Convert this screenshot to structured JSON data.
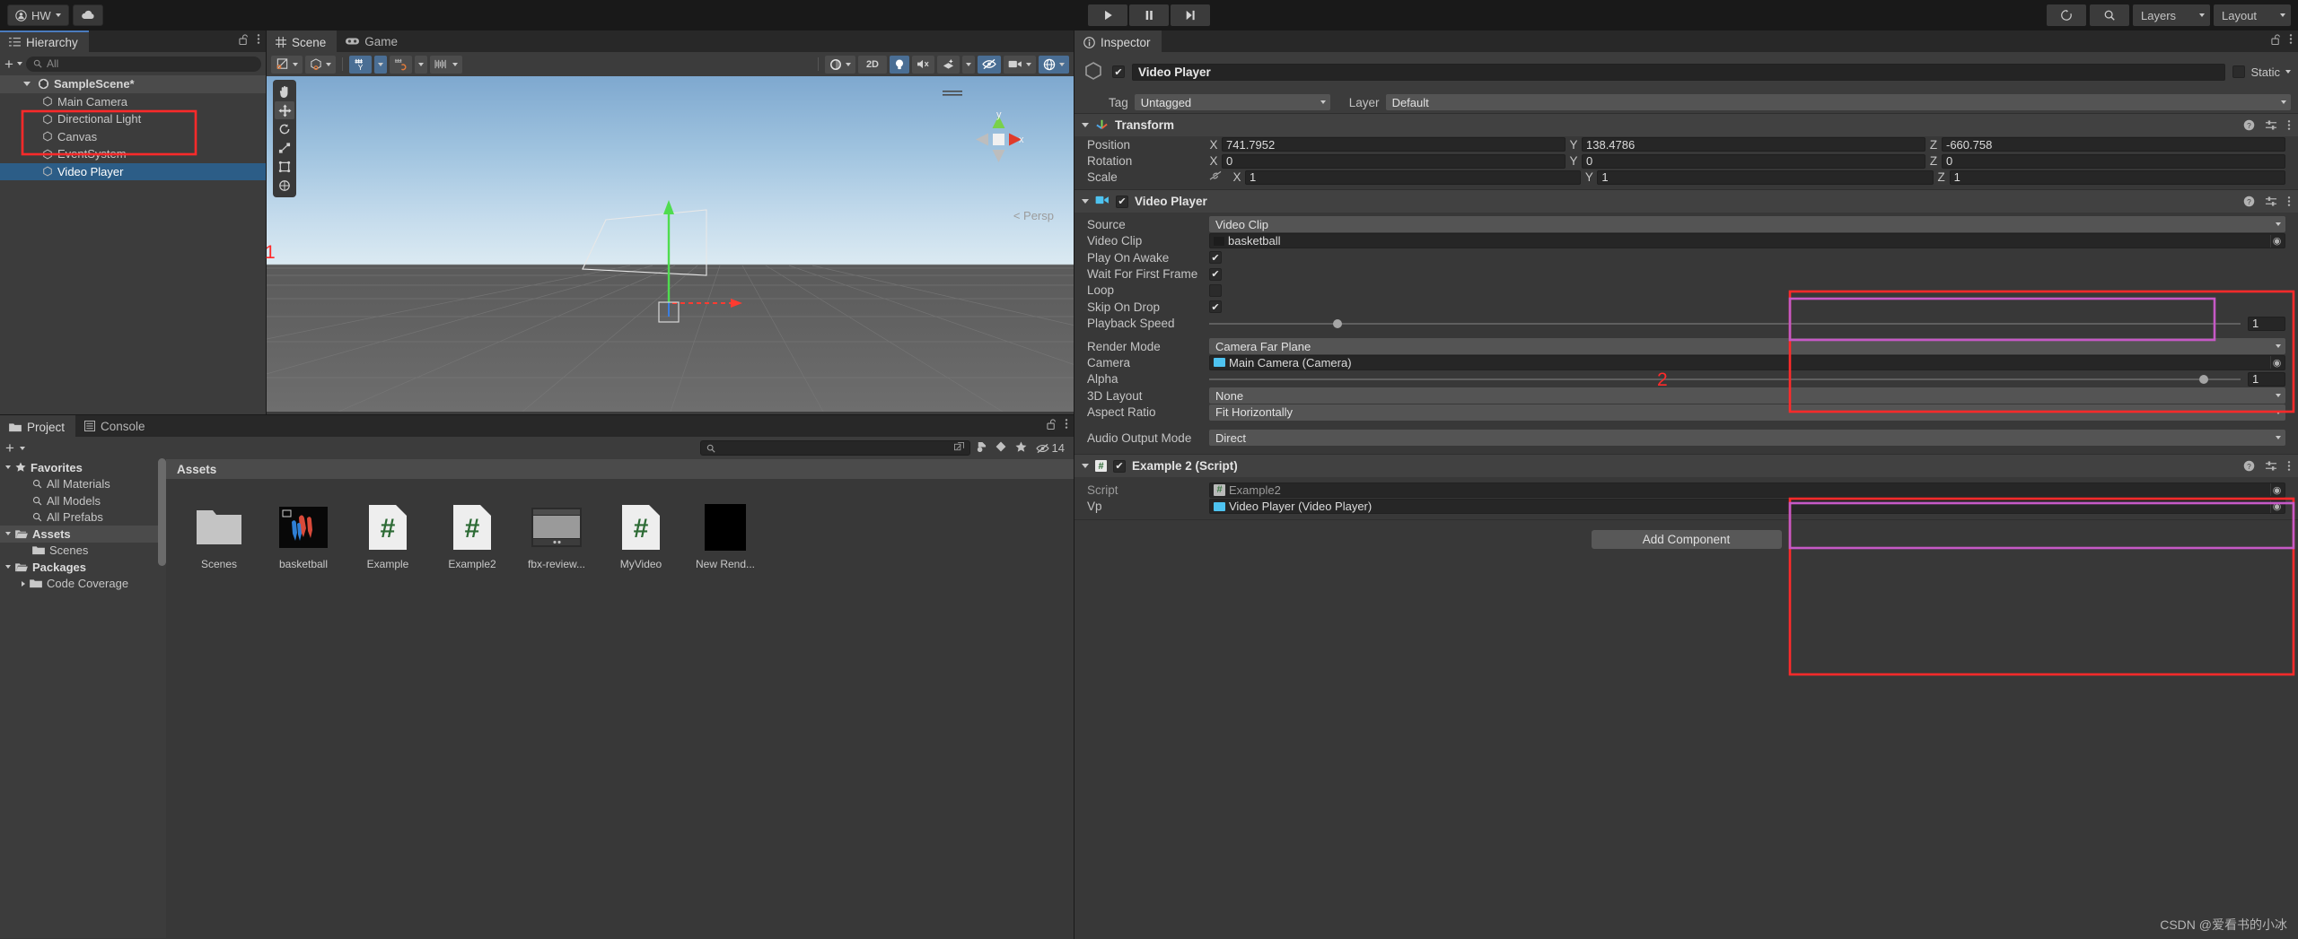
{
  "topbar": {
    "account": "HW",
    "account_icon": "person-icon",
    "cloud_icon": "cloud-icon",
    "play": "play-icon",
    "pause": "pause-icon",
    "step": "step-icon",
    "history_icon": "history-icon",
    "search_icon": "search-icon",
    "layers": "Layers",
    "layout": "Layout"
  },
  "hierarchy": {
    "tab": "Hierarchy",
    "tab_icon": "hierarchy-icon",
    "lock_icon": "lock-open-icon",
    "menu_icon": "kebab-menu-icon",
    "add_label": "+",
    "search_placeholder": "All",
    "items": [
      {
        "label": "SampleScene*",
        "type": "scene",
        "depth": 0
      },
      {
        "label": "Main Camera",
        "type": "object",
        "depth": 1
      },
      {
        "label": "Directional Light",
        "type": "object",
        "depth": 1
      },
      {
        "label": "Canvas",
        "type": "object",
        "depth": 1
      },
      {
        "label": "EventSystem",
        "type": "object",
        "depth": 1
      },
      {
        "label": "Video Player",
        "type": "object",
        "depth": 1,
        "selected": true
      }
    ]
  },
  "scene": {
    "tabs": [
      {
        "label": "Scene",
        "icon": "grid-icon",
        "active": true
      },
      {
        "label": "Game",
        "icon": "gamepad-icon",
        "active": false
      }
    ],
    "lock_icon": "lock-open-icon",
    "menu_icon": "kebab-menu-icon",
    "toolbar_left": [
      {
        "name": "pivot-mode",
        "label": "⊘"
      },
      {
        "name": "handle-space",
        "label": "⬚"
      },
      {
        "name": "grid-snap",
        "label": "✥",
        "active": true
      },
      {
        "name": "magnet-snap",
        "label": "⌗"
      },
      {
        "name": "ruler",
        "label": "|||"
      }
    ],
    "toolbar_right": [
      {
        "name": "shading-mode",
        "label": "◐"
      },
      {
        "name": "2d-toggle",
        "label": "2D"
      },
      {
        "name": "lighting-toggle",
        "label": "💡",
        "active": true
      },
      {
        "name": "audio-toggle",
        "label": "🔇"
      },
      {
        "name": "fx-toggle",
        "label": "✨"
      },
      {
        "name": "hidden-toggle",
        "label": "👁",
        "active": true
      },
      {
        "name": "camera-toggle",
        "label": "🎥"
      },
      {
        "name": "gizmo-toggle",
        "label": "◉",
        "active": true
      }
    ],
    "tools": [
      {
        "name": "hand-tool",
        "glyph": "✋"
      },
      {
        "name": "move-tool",
        "glyph": "✥",
        "active": true
      },
      {
        "name": "rotate-tool",
        "glyph": "↻"
      },
      {
        "name": "scale-tool",
        "glyph": "⤢"
      },
      {
        "name": "rect-tool",
        "glyph": "⬚"
      },
      {
        "name": "transform-tool",
        "glyph": "✦"
      }
    ],
    "persp_label": "Persp",
    "gizmo_axis_y": "y",
    "gizmo_axis_x": "x"
  },
  "inspector": {
    "tab": "Inspector",
    "tab_icon": "info-icon",
    "lock_icon": "lock-open-icon",
    "menu_icon": "kebab-menu-icon",
    "object_name": "Video Player",
    "enabled": true,
    "static_label": "Static",
    "static_checked": false,
    "tag_label": "Tag",
    "tag_value": "Untagged",
    "layer_label": "Layer",
    "layer_value": "Default",
    "transform": {
      "title": "Transform",
      "icon": "transform-axis-icon",
      "rows": [
        {
          "label": "Position",
          "x": "741.7952",
          "y": "138.4786",
          "z": "-660.758"
        },
        {
          "label": "Rotation",
          "x": "0",
          "y": "0",
          "z": "0"
        },
        {
          "label": "Scale",
          "x": "1",
          "y": "1",
          "z": "1",
          "link_icon": "link-off-icon"
        }
      ],
      "axes": [
        "X",
        "Y",
        "Z"
      ]
    },
    "video_player": {
      "title": "Video Player",
      "icon": "video-icon",
      "enabled": true,
      "source_label": "Source",
      "source_value": "Video Clip",
      "clip_label": "Video Clip",
      "clip_value": "basketball",
      "toggles": [
        {
          "label": "Play On Awake",
          "checked": true
        },
        {
          "label": "Wait For First Frame",
          "checked": true
        },
        {
          "label": "Loop",
          "checked": false
        },
        {
          "label": "Skip On Drop",
          "checked": true
        }
      ],
      "playback_speed_label": "Playback Speed",
      "playback_speed_value": "1",
      "playback_speed_pct": 12,
      "render_mode_label": "Render Mode",
      "render_mode_value": "Camera Far Plane",
      "camera_label": "Camera",
      "camera_value": "Main Camera (Camera)",
      "alpha_label": "Alpha",
      "alpha_value": "1",
      "alpha_pct": 96,
      "layout3d_label": "3D Layout",
      "layout3d_value": "None",
      "aspect_label": "Aspect Ratio",
      "aspect_value": "Fit Horizontally",
      "audio_label": "Audio Output Mode",
      "audio_value": "Direct"
    },
    "script_component": {
      "title": "Example 2 (Script)",
      "icon": "csharp-script-icon",
      "enabled": true,
      "script_label": "Script",
      "script_value": "Example2",
      "vp_label": "Vp",
      "vp_value": "Video Player (Video Player)"
    },
    "add_component": "Add Component"
  },
  "project": {
    "tabs": [
      {
        "label": "Project",
        "icon": "folder-icon",
        "active": true
      },
      {
        "label": "Console",
        "icon": "console-icon",
        "active": false
      }
    ],
    "add_label": "+",
    "search_placeholder": "",
    "search_icon": "search-icon",
    "toolbar_icons": [
      "save-search-icon",
      "label-icon",
      "favorite-star-icon"
    ],
    "hidden_count": "14",
    "hidden_icon": "eye-off-icon",
    "tree": [
      {
        "label": "Favorites",
        "icon": "star-icon",
        "depth": 0,
        "bold": true,
        "arrow": "down"
      },
      {
        "label": "All Materials",
        "icon": "search-icon",
        "depth": 1
      },
      {
        "label": "All Models",
        "icon": "search-icon",
        "depth": 1
      },
      {
        "label": "All Prefabs",
        "icon": "search-icon",
        "depth": 1
      },
      {
        "label": "Assets",
        "icon": "folder-open-icon",
        "depth": 0,
        "bold": true,
        "arrow": "down",
        "selected": true
      },
      {
        "label": "Scenes",
        "icon": "folder-icon",
        "depth": 1
      },
      {
        "label": "Packages",
        "icon": "folder-open-icon",
        "depth": 0,
        "bold": true,
        "arrow": "down"
      },
      {
        "label": "Code Coverage",
        "icon": "folder-icon",
        "depth": 1,
        "arrow": "right"
      }
    ],
    "assets_header": "Assets",
    "assets": [
      {
        "label": "Scenes",
        "kind": "folder"
      },
      {
        "label": "basketball",
        "kind": "video"
      },
      {
        "label": "Example",
        "kind": "script"
      },
      {
        "label": "Example2",
        "kind": "script"
      },
      {
        "label": "fbx-review...",
        "kind": "image"
      },
      {
        "label": "MyVideo",
        "kind": "script"
      },
      {
        "label": "New Rend...",
        "kind": "rendertexture"
      }
    ]
  },
  "annotations": [
    {
      "label": "1",
      "color": "#ff2a2a"
    },
    {
      "label": "2",
      "color": "#ff2a2a"
    }
  ],
  "watermark": "CSDN @爱看书的小冰",
  "colors": {
    "accent_blue": "#4b7bbd",
    "selection": "#2c5d87",
    "anno_red": "#ff2a2a",
    "anno_magenta": "#c659c6",
    "panel": "#383838"
  }
}
